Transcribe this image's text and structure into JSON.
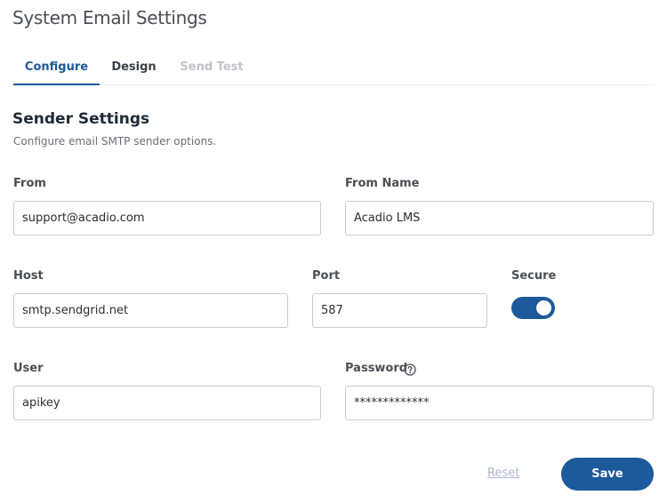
{
  "page": {
    "title": "System Email Settings"
  },
  "tabs": [
    {
      "label": "Configure",
      "state": "active"
    },
    {
      "label": "Design",
      "state": "normal"
    },
    {
      "label": "Send Test",
      "state": "disabled"
    }
  ],
  "section": {
    "title": "Sender Settings",
    "subtitle": "Configure email SMTP sender options."
  },
  "fields": {
    "from": {
      "label": "From",
      "value": "support@acadio.com"
    },
    "from_name": {
      "label": "From Name",
      "value": "Acadio LMS"
    },
    "host": {
      "label": "Host",
      "value": "smtp.sendgrid.net"
    },
    "port": {
      "label": "Port",
      "value": "587"
    },
    "secure": {
      "label": "Secure",
      "enabled": true
    },
    "user": {
      "label": "User",
      "value": "apikey"
    },
    "password": {
      "label": "Password",
      "value": "*************",
      "help_icon": "question-circle-icon"
    }
  },
  "actions": {
    "reset_label": "Reset",
    "save_label": "Save"
  },
  "colors": {
    "accent": "#1d5a9b",
    "disabled_text": "#c0c4c8",
    "reset_link": "#a9b9cc"
  }
}
